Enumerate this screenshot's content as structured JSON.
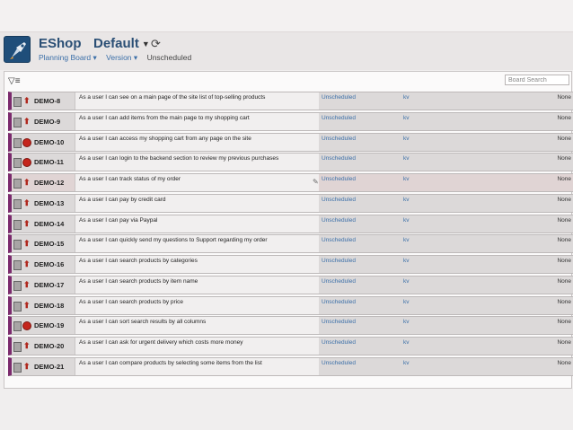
{
  "app": {
    "project_name": "EShop",
    "board_name": "Default",
    "refresh_icon": "refresh-icon",
    "nav": {
      "planning_board": "Planning Board",
      "version": "Version",
      "status": "Unscheduled"
    }
  },
  "toolbar": {
    "filter_icon": "filter-icon",
    "search_placeholder": "Board Search"
  },
  "issues": [
    {
      "key": "DEMO-8",
      "summary": "As a user I can see on a main page of the site list of top-selling products",
      "version": "Unscheduled",
      "assignee": "kv",
      "estimate": "None",
      "priority": "major"
    },
    {
      "key": "DEMO-9",
      "summary": "As a user I can add items from the main page to my shopping cart",
      "version": "Unscheduled",
      "assignee": "kv",
      "estimate": "None",
      "priority": "major"
    },
    {
      "key": "DEMO-10",
      "summary": "As a user I can access my shopping cart from any page on the site",
      "version": "Unscheduled",
      "assignee": "kv",
      "estimate": "None",
      "priority": "blocker"
    },
    {
      "key": "DEMO-11",
      "summary": "As a user I can login to the backend section to review my previous purchases",
      "version": "Unscheduled",
      "assignee": "kv",
      "estimate": "None",
      "priority": "blocker"
    },
    {
      "key": "DEMO-12",
      "summary": "As a user I can track status of my order",
      "version": "Unscheduled",
      "assignee": "kv",
      "estimate": "None",
      "priority": "major"
    },
    {
      "key": "DEMO-13",
      "summary": "As a user I can pay by credit card",
      "version": "Unscheduled",
      "assignee": "kv",
      "estimate": "None",
      "priority": "major"
    },
    {
      "key": "DEMO-14",
      "summary": "As a user I can pay via Paypal",
      "version": "Unscheduled",
      "assignee": "kv",
      "estimate": "None",
      "priority": "major"
    },
    {
      "key": "DEMO-15",
      "summary": "As a user I can quickly send my questions to Support regarding my order",
      "version": "Unscheduled",
      "assignee": "kv",
      "estimate": "None",
      "priority": "major"
    },
    {
      "key": "DEMO-16",
      "summary": "As a user I can search products by categories",
      "version": "Unscheduled",
      "assignee": "kv",
      "estimate": "None",
      "priority": "major"
    },
    {
      "key": "DEMO-17",
      "summary": "As a user I can search products by item name",
      "version": "Unscheduled",
      "assignee": "kv",
      "estimate": "None",
      "priority": "major"
    },
    {
      "key": "DEMO-18",
      "summary": "As a user I can search products by price",
      "version": "Unscheduled",
      "assignee": "kv",
      "estimate": "None",
      "priority": "major"
    },
    {
      "key": "DEMO-19",
      "summary": "As a user I can sort search results by all columns",
      "version": "Unscheduled",
      "assignee": "kv",
      "estimate": "None",
      "priority": "blocker"
    },
    {
      "key": "DEMO-20",
      "summary": "As a user I can ask for urgent delivery which costs more money",
      "version": "Unscheduled",
      "assignee": "kv",
      "estimate": "None",
      "priority": "major"
    },
    {
      "key": "DEMO-21",
      "summary": "As a user I can compare products by selecting some items from the list",
      "version": "Unscheduled",
      "assignee": "kv",
      "estimate": "None",
      "priority": "major"
    }
  ],
  "colors": {
    "accent": "#7b2a6d",
    "link": "#3b6fa8",
    "title": "#2b4f75"
  }
}
